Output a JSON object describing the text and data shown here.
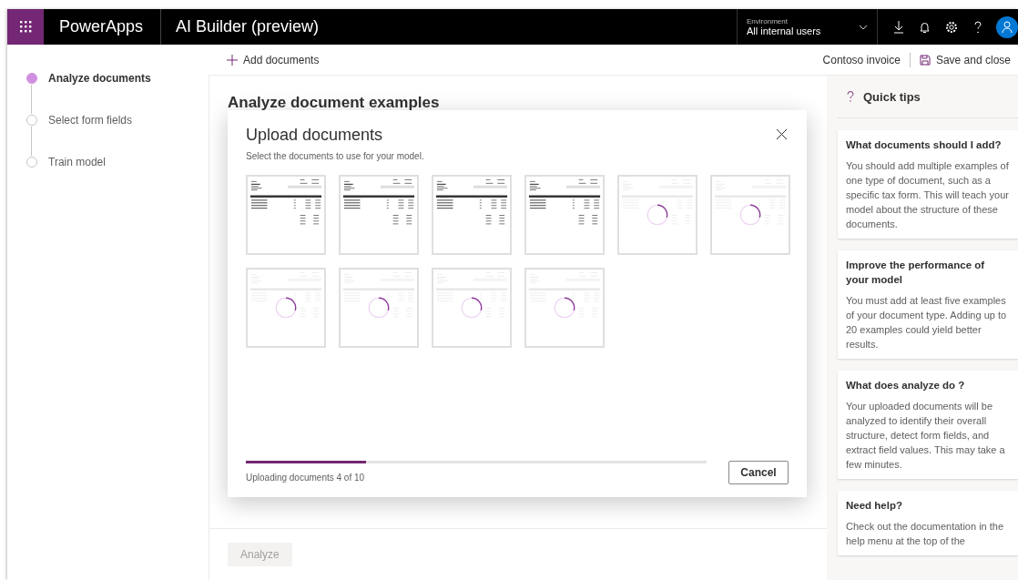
{
  "app": {
    "name": "PowerApps",
    "title": "AI Builder (preview)",
    "environment": {
      "label": "Environment",
      "value": "All internal users"
    }
  },
  "steps": [
    {
      "label": "Analyze documents",
      "selected": true
    },
    {
      "label": "Select form fields",
      "selected": false
    },
    {
      "label": "Train model",
      "selected": false
    }
  ],
  "toolbar": {
    "add": "Add documents",
    "model_name": "Contoso invoice",
    "save": "Save and close"
  },
  "page": {
    "heading": "Analyze document examples",
    "analyze_button": {
      "label": "Analyze",
      "disabled": true
    }
  },
  "dialog": {
    "title": "Upload documents",
    "subtitle": "Select the documents to use for your model.",
    "documents": [
      {
        "uploaded": true
      },
      {
        "uploaded": true
      },
      {
        "uploaded": true
      },
      {
        "uploaded": true
      },
      {
        "uploaded": false
      },
      {
        "uploaded": false
      },
      {
        "uploaded": false
      },
      {
        "uploaded": false
      },
      {
        "uploaded": false
      },
      {
        "uploaded": false
      }
    ],
    "progress": {
      "level": 0.26
    },
    "status": "Uploading documents 4 of 10",
    "cancel": "Cancel"
  },
  "quick_tips": {
    "title": "Quick tips",
    "cards": [
      {
        "title": "What documents should I add?",
        "body": "You should add multiple examples of one type of document, such as a specific tax form. This will teach your model about the structure of these documents."
      },
      {
        "title": "Improve the performance of your model",
        "body": "You must add at least five examples of your document type. Adding up to 20 examples could yield better results."
      },
      {
        "title": "What does analyze do ?",
        "body": "Your uploaded documents will be analyzed to identify their overall structure, detect form fields, and extract field values. This may take a few minutes."
      },
      {
        "title": "Need help?",
        "body": "Check out the documentation in the help menu at the top of the"
      }
    ]
  }
}
